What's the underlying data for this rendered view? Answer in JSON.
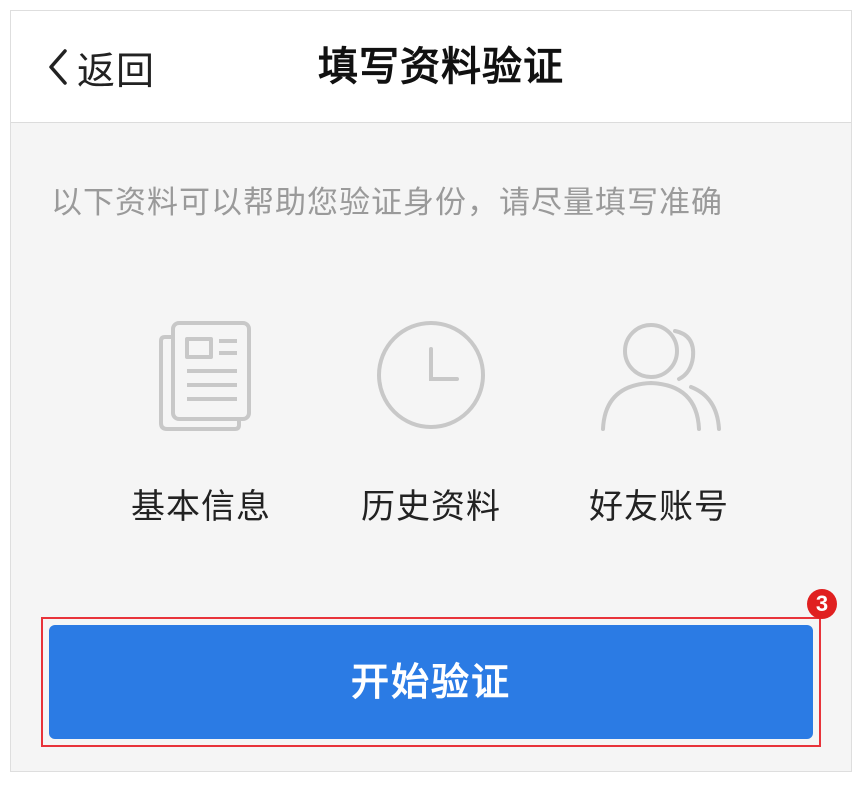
{
  "navbar": {
    "back_label": "返回",
    "title": "填写资料验证"
  },
  "hint": "以下资料可以帮助您验证身份，请尽量填写准确",
  "features": [
    {
      "icon": "document-icon",
      "label": "基本信息"
    },
    {
      "icon": "clock-icon",
      "label": "历史资料"
    },
    {
      "icon": "friends-icon",
      "label": "好友账号"
    }
  ],
  "action": {
    "label": "开始验证",
    "step_badge": "3"
  },
  "colors": {
    "primary": "#2b7be4",
    "highlight": "#e8333a",
    "hint_text": "#9a9a9a",
    "icon_stroke": "#c8c8c8"
  }
}
